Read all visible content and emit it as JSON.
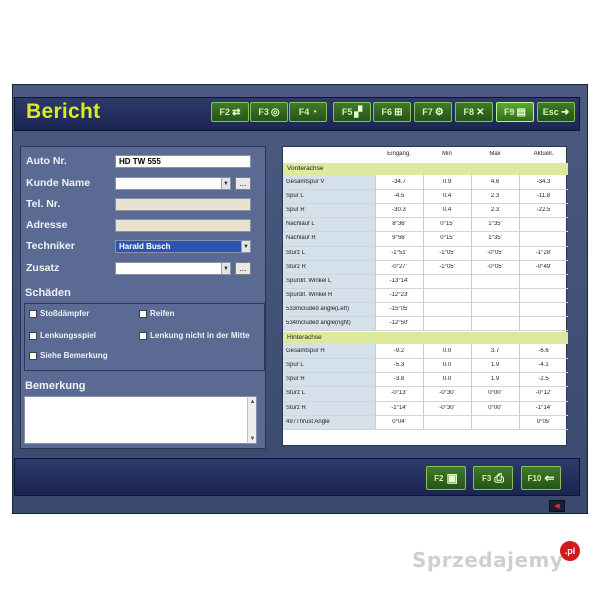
{
  "window": {
    "title": "Bericht"
  },
  "toolbar": [
    {
      "key": "F2",
      "icon": "car-icon",
      "glyph": "⇄"
    },
    {
      "key": "F3",
      "icon": "wheel-icon",
      "glyph": "◎"
    },
    {
      "key": "F4",
      "icon": "gauge-icon",
      "glyph": "◔"
    },
    {
      "key": "F5",
      "icon": "chart-icon",
      "glyph": "▞"
    },
    {
      "key": "F6",
      "icon": "axle-icon",
      "glyph": "⊞"
    },
    {
      "key": "F7",
      "icon": "adjust-icon",
      "glyph": "⚙"
    },
    {
      "key": "F8",
      "icon": "tools-icon",
      "glyph": "✕"
    },
    {
      "key": "F9",
      "icon": "report-icon",
      "glyph": "▤"
    },
    {
      "key": "Esc",
      "icon": "exit-icon",
      "glyph": "➜"
    }
  ],
  "form": {
    "auto_nr": {
      "label": "Auto Nr.",
      "value": "HD TW 555"
    },
    "kunde_name": {
      "label": "Kunde Name",
      "value": ""
    },
    "tel_nr": {
      "label": "Tel. Nr.",
      "value": ""
    },
    "adresse": {
      "label": "Adresse",
      "value": ""
    },
    "techniker": {
      "label": "Techniker",
      "value": "Harald Busch"
    },
    "zusatz": {
      "label": "Zusatz",
      "value": ""
    },
    "ellipsis": "..."
  },
  "schaeden": {
    "title": "Schäden",
    "items": [
      "Stoßdämpfer",
      "Reifen",
      "Lenkungsspiel",
      "Lenkung nicht in der Mitte",
      "Siehe Bemerkung"
    ]
  },
  "bemerkung": {
    "title": "Bemerkung",
    "value": ""
  },
  "table": {
    "headers": [
      "",
      "Eingang.",
      "Min",
      "Max",
      "Aktuell."
    ],
    "sections": [
      {
        "name": "Vorderachse",
        "rows": [
          [
            "Gesamtspur V",
            "-34.7",
            "0.9",
            "4.6",
            "-34.3"
          ],
          [
            "Spur L",
            "-4.5",
            "0.4",
            "2.3",
            "-11.8"
          ],
          [
            "Spur R",
            "-30.3",
            "0.4",
            "2.3",
            "-22.5"
          ],
          [
            "Nachlauf L",
            "8°36'",
            "0°15'",
            "1°35'",
            ""
          ],
          [
            "Nachlauf R",
            "9°56'",
            "0°15'",
            "1°35'",
            ""
          ],
          [
            "Sturz L",
            "-1°51'",
            "-1°05'",
            "-0°05'",
            "-1°28'"
          ],
          [
            "Sturz R",
            "-0°27'",
            "-1°05'",
            "-0°05'",
            "-0°49'"
          ],
          [
            "Spurdif. Winkel L",
            "-13°14'",
            "",
            "",
            ""
          ],
          [
            "Spurdif. Winkel R",
            "-12°23'",
            "",
            "",
            ""
          ],
          [
            "533Included angle(Left)",
            "-15°05'",
            "",
            "",
            ""
          ],
          [
            "534Included angle(right)",
            "-12°50'",
            "",
            "",
            ""
          ]
        ]
      },
      {
        "name": "Hinterachse",
        "rows": [
          [
            "Gesamtspur H",
            "-9.2",
            "0.0",
            "3.7",
            "-6.6"
          ],
          [
            "Spur L",
            "-5.3",
            "0.0",
            "1.9",
            "-4.1"
          ],
          [
            "Spur R",
            "-3.8",
            "0.0",
            "1.9",
            "-2.5"
          ],
          [
            "Sturz L",
            "-0°13'",
            "-0°30'",
            "0°00'",
            "-0°12'"
          ],
          [
            "Sturz R",
            "-1°14'",
            "-0°30'",
            "0°00'",
            "-1°14'"
          ],
          [
            "497Thrust Angle",
            "0°04'",
            "",
            "",
            "0°05'"
          ]
        ]
      }
    ]
  },
  "footer": [
    {
      "key": "F2",
      "icon": "save-icon",
      "glyph": "▣"
    },
    {
      "key": "F3",
      "icon": "print-icon",
      "glyph": "⎙"
    },
    {
      "key": "F10",
      "icon": "back-arrow-icon",
      "glyph": "⇐"
    }
  ],
  "watermark": {
    "text": "Sprzedajemy",
    "badge": ".pl"
  },
  "colors": {
    "title": "#d8ee1a",
    "section_bg": "#dde99c",
    "name_col_bg": "#d4e0ea",
    "key_green": "#3f7a2a"
  }
}
